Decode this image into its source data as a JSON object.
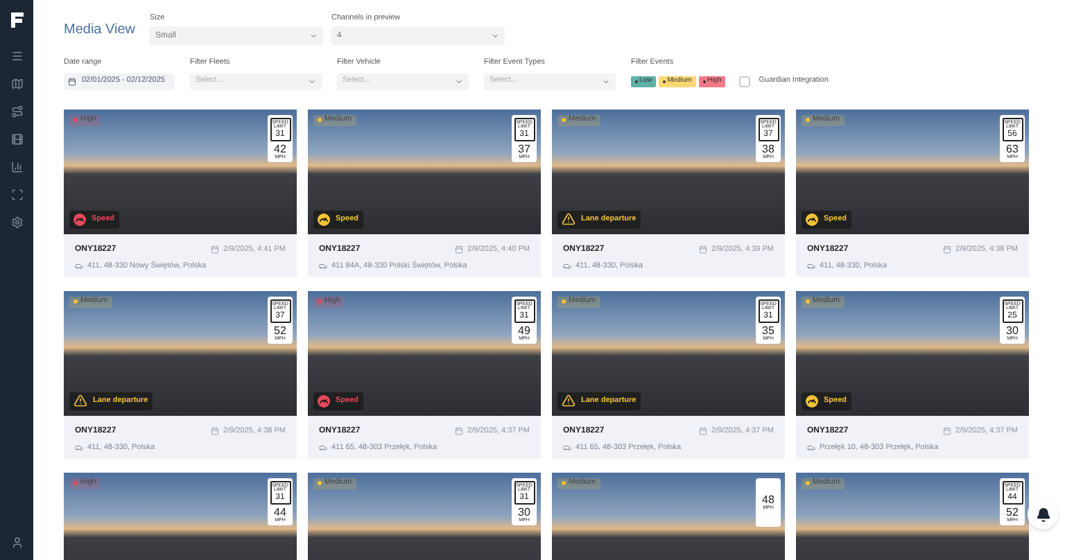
{
  "page_title": "Media View",
  "top_selects": [
    {
      "label": "Size",
      "value": "Small"
    },
    {
      "label": "Channels in preview",
      "value": "4"
    }
  ],
  "filters": [
    {
      "kind": "date",
      "label": "Date range",
      "value": "02/01/2025 - 02/12/2025"
    },
    {
      "kind": "select",
      "label": "Filter Fleets",
      "placeholder": "Select..."
    },
    {
      "kind": "select",
      "label": "Filter Vehicle",
      "placeholder": "Select..."
    },
    {
      "kind": "select",
      "label": "Filter Event Types",
      "placeholder": "Select..."
    }
  ],
  "event_filter": {
    "label": "Filter Events",
    "chips": [
      {
        "label": "Low",
        "color": "#5fb0a8"
      },
      {
        "label": "Medium",
        "color": "#fcd774"
      },
      {
        "label": "High",
        "color": "#f27a86"
      }
    ]
  },
  "guardian": {
    "label": "Guardian Integration",
    "checked": false
  },
  "cards": [
    {
      "color": "#e8495a",
      "severity_label": "High",
      "sign_top": "SPEED",
      "sign_mid": "LIMIT",
      "limit": "31",
      "speed": "42",
      "unit": "MPH",
      "kind": "speed",
      "event_label": "Speed",
      "vehicle": "ONY18227",
      "date": "2/9/2025, 4:41 PM",
      "address": "411, 48-330 Nowy Świętów, Polska"
    },
    {
      "color": "#f5c236",
      "severity_label": "Medium",
      "sign_top": "SPEED",
      "sign_mid": "LIMIT",
      "limit": "31",
      "speed": "37",
      "unit": "MPH",
      "kind": "speed",
      "event_label": "Speed",
      "vehicle": "ONY18227",
      "date": "2/9/2025, 4:40 PM",
      "address": "411 84A, 48-330 Polski Świętów, Polska"
    },
    {
      "color": "#f5c236",
      "severity_label": "Medium",
      "sign_top": "SPEED",
      "sign_mid": "LIMIT",
      "limit": "37",
      "speed": "38",
      "unit": "MPH",
      "kind": "lane",
      "event_label": "Lane departure",
      "vehicle": "ONY18227",
      "date": "2/9/2025, 4:39 PM",
      "address": "411, 48-330, Polska"
    },
    {
      "color": "#f5c236",
      "severity_label": "Medium",
      "sign_top": "SPEED",
      "sign_mid": "LIMIT",
      "limit": "56",
      "speed": "63",
      "unit": "MPH",
      "kind": "speed",
      "event_label": "Speed",
      "vehicle": "ONY18227",
      "date": "2/9/2025, 4:38 PM",
      "address": "411, 48-330, Polska"
    },
    {
      "color": "#f5c236",
      "severity_label": "Medium",
      "sign_top": "SPEED",
      "sign_mid": "LIMIT",
      "limit": "37",
      "speed": "52",
      "unit": "MPH",
      "kind": "lane",
      "event_label": "Lane departure",
      "vehicle": "ONY18227",
      "date": "2/9/2025, 4:38 PM",
      "address": "411, 48-330, Polska"
    },
    {
      "color": "#e8495a",
      "severity_label": "High",
      "sign_top": "SPEED",
      "sign_mid": "LIMIT",
      "limit": "31",
      "speed": "49",
      "unit": "MPH",
      "kind": "speed",
      "event_label": "Speed",
      "vehicle": "ONY18227",
      "date": "2/9/2025, 4:37 PM",
      "address": "411 65, 48-303 Przełęk, Polska"
    },
    {
      "color": "#f5c236",
      "severity_label": "Medium",
      "sign_top": "SPEED",
      "sign_mid": "LIMIT",
      "limit": "31",
      "speed": "35",
      "unit": "MPH",
      "kind": "lane",
      "event_label": "Lane departure",
      "vehicle": "ONY18227",
      "date": "2/9/2025, 4:37 PM",
      "address": "411 65, 48-303 Przełęk, Polska"
    },
    {
      "color": "#f5c236",
      "severity_label": "Medium",
      "sign_top": "SPEED",
      "sign_mid": "LIMIT",
      "limit": "25",
      "speed": "30",
      "unit": "MPH",
      "kind": "speed",
      "event_label": "Speed",
      "vehicle": "ONY18227",
      "date": "2/9/2025, 4:37 PM",
      "address": "Przełęk 10, 48-303 Przełęk, Polska"
    },
    {
      "color": "#e8495a",
      "severity_label": "High",
      "sign_top": "SPEED",
      "sign_mid": "LIMIT",
      "limit": "31",
      "speed": "44",
      "unit": "MPH"
    },
    {
      "color": "#f5c236",
      "severity_label": "Medium",
      "sign_top": "SPEED",
      "sign_mid": "LIMIT",
      "limit": "31",
      "speed": "30",
      "unit": "MPH"
    },
    {
      "color": "#f5c236",
      "severity_label": "Medium",
      "speed": "48",
      "unit": "MPH"
    },
    {
      "color": "#f5c236",
      "severity_label": "Medium",
      "sign_top": "SPEED",
      "sign_mid": "LIMIT",
      "limit": "44",
      "speed": "52",
      "unit": "MPH"
    }
  ]
}
